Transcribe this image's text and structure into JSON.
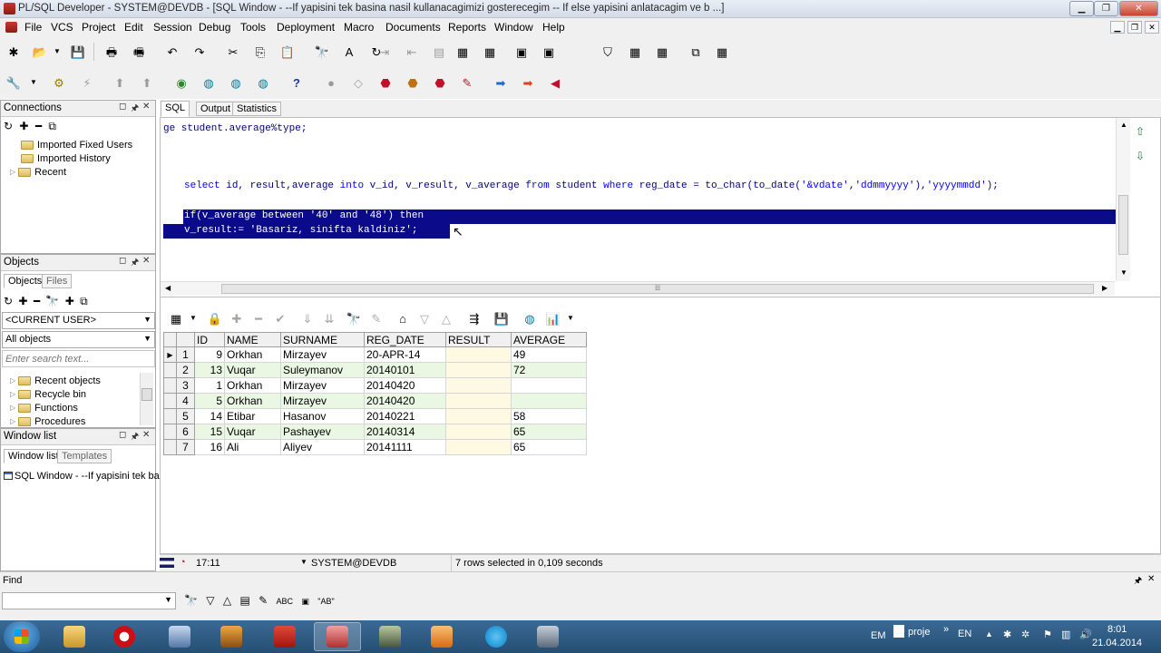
{
  "window": {
    "title": "PL/SQL Developer - SYSTEM@DEVDB - [SQL Window - --If yapisini tek basina nasil kullanacagimizi gosterecegim -- If else yapisini anlatacagim ve b ...]"
  },
  "menu": {
    "items": [
      "File",
      "VCS",
      "Project",
      "Edit",
      "Session",
      "Debug",
      "Tools",
      "Deployment",
      "Macro",
      "Documents",
      "Reports",
      "Window",
      "Help"
    ]
  },
  "connections": {
    "title": "Connections",
    "items": [
      "Imported Fixed Users",
      "Imported History",
      "Recent"
    ]
  },
  "objects": {
    "title": "Objects",
    "tabs": [
      "Objects",
      "Files"
    ],
    "user_combo": "<CURRENT USER>",
    "filter_combo": "All objects",
    "search_placeholder": "Enter search text...",
    "items": [
      "Recent objects",
      "Recycle bin",
      "Functions",
      "Procedures"
    ]
  },
  "window_list": {
    "title": "Window list",
    "tabs": [
      "Window list",
      "Templates"
    ],
    "items": [
      "SQL Window - --If yapisini tek basi"
    ]
  },
  "editor": {
    "tabs": [
      "SQL",
      "Output",
      "Statistics"
    ],
    "active_tab": "SQL"
  },
  "grid": {
    "columns": [
      "ID",
      "NAME",
      "SURNAME",
      "REG_DATE",
      "RESULT",
      "AVERAGE"
    ],
    "rows": [
      {
        "n": "1",
        "id": "9",
        "name": "Orkhan",
        "surname": "Mirzayev",
        "reg_date": "20-APR-14",
        "result": "",
        "average": "49"
      },
      {
        "n": "2",
        "id": "13",
        "name": "Vuqar",
        "surname": "Suleymanov",
        "reg_date": "20140101",
        "result": "",
        "average": "72"
      },
      {
        "n": "3",
        "id": "1",
        "name": "Orkhan",
        "surname": "Mirzayev",
        "reg_date": "20140420",
        "result": "",
        "average": ""
      },
      {
        "n": "4",
        "id": "5",
        "name": "Orkhan",
        "surname": "Mirzayev",
        "reg_date": "20140420",
        "result": "",
        "average": ""
      },
      {
        "n": "5",
        "id": "14",
        "name": "Etibar",
        "surname": "Hasanov",
        "reg_date": "20140221",
        "result": "",
        "average": "58"
      },
      {
        "n": "6",
        "id": "15",
        "name": "Vuqar",
        "surname": "Pashayev",
        "reg_date": "20140314",
        "result": "",
        "average": "65"
      },
      {
        "n": "7",
        "id": "16",
        "name": "Ali",
        "surname": "Aliyev",
        "reg_date": "20141111",
        "result": "",
        "average": "65"
      }
    ]
  },
  "status": {
    "time": "17:11",
    "connection": "SYSTEM@DEVDB",
    "message": "7 rows selected in 0,109 seconds"
  },
  "find": {
    "label": "Find",
    "input_value": ""
  },
  "taskbar": {
    "lang_em": "EM",
    "task_label": "proje",
    "lang_en": "EN",
    "time": "8:01",
    "date": "21.04.2014"
  },
  "colors": {
    "selection": "#0a0a8a",
    "keyword": "#0000ff",
    "identifier": "#000080",
    "row_alt": "#eaf7e3",
    "result_cell": "#fdf9e2"
  }
}
